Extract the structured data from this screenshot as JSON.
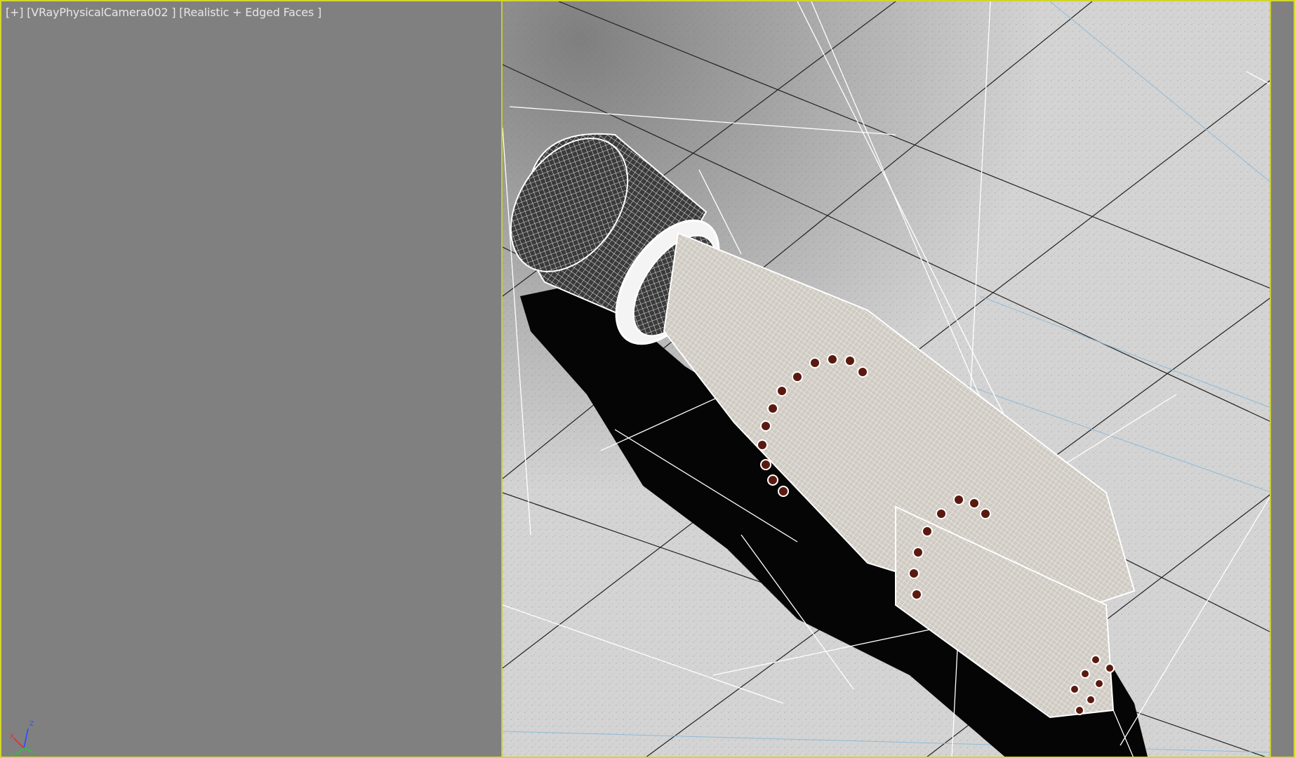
{
  "viewport": {
    "label_plus": "[+]",
    "label_camera": "[VRayPhysicalCamera002 ]",
    "label_shading": "[Realistic + Edged Faces ]",
    "border_color": "#d3d62a",
    "background_color": "#808080"
  },
  "axis_tripod": {
    "x": "X",
    "y": "Y",
    "z": "Z"
  },
  "scene": {
    "object": "cable-wireframe-model",
    "shading": "realistic-edged-faces"
  }
}
